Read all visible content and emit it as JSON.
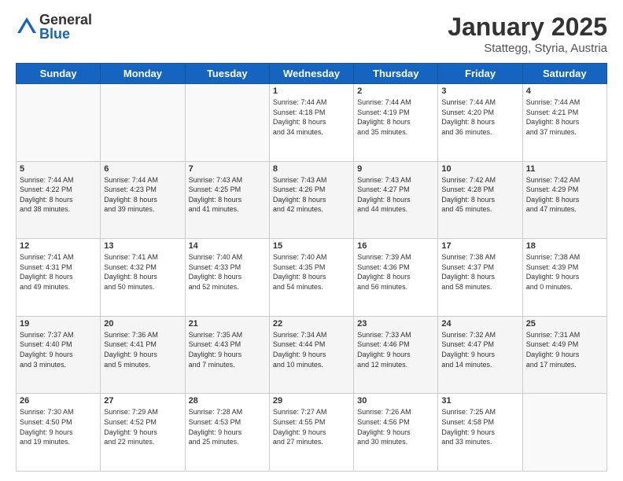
{
  "logo": {
    "general": "General",
    "blue": "Blue"
  },
  "title": "January 2025",
  "subtitle": "Stattegg, Styria, Austria",
  "days_of_week": [
    "Sunday",
    "Monday",
    "Tuesday",
    "Wednesday",
    "Thursday",
    "Friday",
    "Saturday"
  ],
  "weeks": [
    [
      {
        "day": "",
        "info": ""
      },
      {
        "day": "",
        "info": ""
      },
      {
        "day": "",
        "info": ""
      },
      {
        "day": "1",
        "info": "Sunrise: 7:44 AM\nSunset: 4:18 PM\nDaylight: 8 hours\nand 34 minutes."
      },
      {
        "day": "2",
        "info": "Sunrise: 7:44 AM\nSunset: 4:19 PM\nDaylight: 8 hours\nand 35 minutes."
      },
      {
        "day": "3",
        "info": "Sunrise: 7:44 AM\nSunset: 4:20 PM\nDaylight: 8 hours\nand 36 minutes."
      },
      {
        "day": "4",
        "info": "Sunrise: 7:44 AM\nSunset: 4:21 PM\nDaylight: 8 hours\nand 37 minutes."
      }
    ],
    [
      {
        "day": "5",
        "info": "Sunrise: 7:44 AM\nSunset: 4:22 PM\nDaylight: 8 hours\nand 38 minutes."
      },
      {
        "day": "6",
        "info": "Sunrise: 7:44 AM\nSunset: 4:23 PM\nDaylight: 8 hours\nand 39 minutes."
      },
      {
        "day": "7",
        "info": "Sunrise: 7:43 AM\nSunset: 4:25 PM\nDaylight: 8 hours\nand 41 minutes."
      },
      {
        "day": "8",
        "info": "Sunrise: 7:43 AM\nSunset: 4:26 PM\nDaylight: 8 hours\nand 42 minutes."
      },
      {
        "day": "9",
        "info": "Sunrise: 7:43 AM\nSunset: 4:27 PM\nDaylight: 8 hours\nand 44 minutes."
      },
      {
        "day": "10",
        "info": "Sunrise: 7:42 AM\nSunset: 4:28 PM\nDaylight: 8 hours\nand 45 minutes."
      },
      {
        "day": "11",
        "info": "Sunrise: 7:42 AM\nSunset: 4:29 PM\nDaylight: 8 hours\nand 47 minutes."
      }
    ],
    [
      {
        "day": "12",
        "info": "Sunrise: 7:41 AM\nSunset: 4:31 PM\nDaylight: 8 hours\nand 49 minutes."
      },
      {
        "day": "13",
        "info": "Sunrise: 7:41 AM\nSunset: 4:32 PM\nDaylight: 8 hours\nand 50 minutes."
      },
      {
        "day": "14",
        "info": "Sunrise: 7:40 AM\nSunset: 4:33 PM\nDaylight: 8 hours\nand 52 minutes."
      },
      {
        "day": "15",
        "info": "Sunrise: 7:40 AM\nSunset: 4:35 PM\nDaylight: 8 hours\nand 54 minutes."
      },
      {
        "day": "16",
        "info": "Sunrise: 7:39 AM\nSunset: 4:36 PM\nDaylight: 8 hours\nand 56 minutes."
      },
      {
        "day": "17",
        "info": "Sunrise: 7:38 AM\nSunset: 4:37 PM\nDaylight: 8 hours\nand 58 minutes."
      },
      {
        "day": "18",
        "info": "Sunrise: 7:38 AM\nSunset: 4:39 PM\nDaylight: 9 hours\nand 0 minutes."
      }
    ],
    [
      {
        "day": "19",
        "info": "Sunrise: 7:37 AM\nSunset: 4:40 PM\nDaylight: 9 hours\nand 3 minutes."
      },
      {
        "day": "20",
        "info": "Sunrise: 7:36 AM\nSunset: 4:41 PM\nDaylight: 9 hours\nand 5 minutes."
      },
      {
        "day": "21",
        "info": "Sunrise: 7:35 AM\nSunset: 4:43 PM\nDaylight: 9 hours\nand 7 minutes."
      },
      {
        "day": "22",
        "info": "Sunrise: 7:34 AM\nSunset: 4:44 PM\nDaylight: 9 hours\nand 10 minutes."
      },
      {
        "day": "23",
        "info": "Sunrise: 7:33 AM\nSunset: 4:46 PM\nDaylight: 9 hours\nand 12 minutes."
      },
      {
        "day": "24",
        "info": "Sunrise: 7:32 AM\nSunset: 4:47 PM\nDaylight: 9 hours\nand 14 minutes."
      },
      {
        "day": "25",
        "info": "Sunrise: 7:31 AM\nSunset: 4:49 PM\nDaylight: 9 hours\nand 17 minutes."
      }
    ],
    [
      {
        "day": "26",
        "info": "Sunrise: 7:30 AM\nSunset: 4:50 PM\nDaylight: 9 hours\nand 19 minutes."
      },
      {
        "day": "27",
        "info": "Sunrise: 7:29 AM\nSunset: 4:52 PM\nDaylight: 9 hours\nand 22 minutes."
      },
      {
        "day": "28",
        "info": "Sunrise: 7:28 AM\nSunset: 4:53 PM\nDaylight: 9 hours\nand 25 minutes."
      },
      {
        "day": "29",
        "info": "Sunrise: 7:27 AM\nSunset: 4:55 PM\nDaylight: 9 hours\nand 27 minutes."
      },
      {
        "day": "30",
        "info": "Sunrise: 7:26 AM\nSunset: 4:56 PM\nDaylight: 9 hours\nand 30 minutes."
      },
      {
        "day": "31",
        "info": "Sunrise: 7:25 AM\nSunset: 4:58 PM\nDaylight: 9 hours\nand 33 minutes."
      },
      {
        "day": "",
        "info": ""
      }
    ]
  ]
}
